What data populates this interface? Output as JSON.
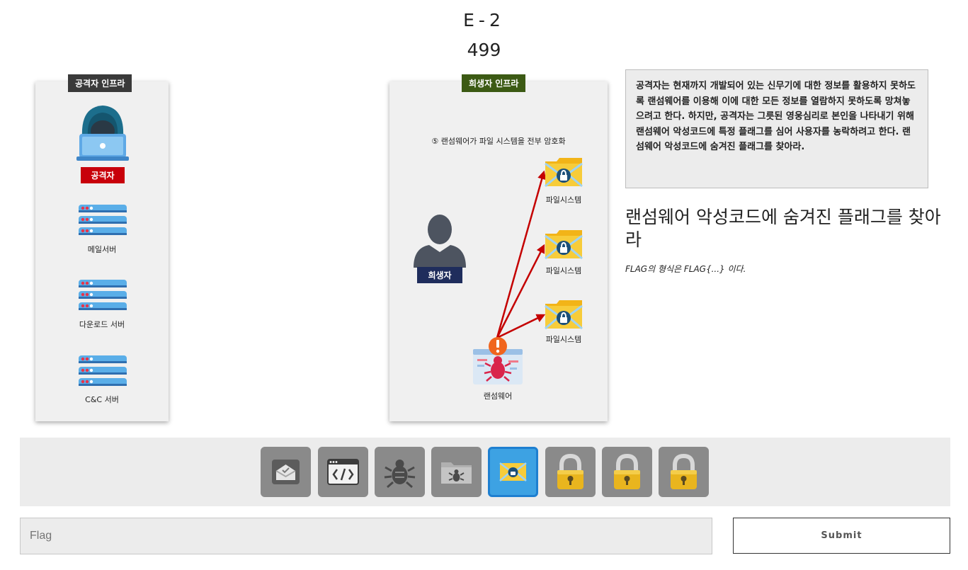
{
  "challenge": {
    "code": "E-2",
    "points": "499"
  },
  "attacker_panel": {
    "tag": "공격자 인프라",
    "attacker_badge": "공격자",
    "servers": [
      {
        "label": "메일서버"
      },
      {
        "label": "다운로드 서버"
      },
      {
        "label": "C&C 서버"
      }
    ]
  },
  "victim_panel": {
    "tag": "희생자 인프라",
    "step_caption": "⑤ 랜섬웨어가 파일 시스템을 전부 암호화",
    "victim_badge": "희생자",
    "filesystems": [
      {
        "label": "파일시스템"
      },
      {
        "label": "파일시스템"
      },
      {
        "label": "파일시스템"
      }
    ],
    "ransomware_label": "랜섬웨어"
  },
  "description": "공격자는 현재까지 개발되어 있는 신무기에 대한 정보를 활용하지 못하도록 랜섬웨어를 이용해 이에 대한 모든 정보를 열람하지 못하도록 망쳐놓으려고 한다. 하지만, 공격자는 그릇된 영웅심리로 본인을 나타내기 위해 랜섬웨어 악성코드에 특정 플래그를 심어 사용자를 농락하려고 한다. 랜섬웨어 악성코드에 숨겨진 플래그를 찾아라.",
  "task": {
    "title": "랜섬웨어 악성코드에 숨겨진 플래그를 찾아라",
    "hint": "FLAG의 형식은 FLAG{...} 이다."
  },
  "toolbar": {
    "items": [
      {
        "icon": "mail-icon",
        "state": "unlocked"
      },
      {
        "icon": "code-window-icon",
        "state": "unlocked"
      },
      {
        "icon": "bug-icon",
        "state": "unlocked"
      },
      {
        "icon": "infected-folder-icon",
        "state": "unlocked"
      },
      {
        "icon": "encrypted-envelope-icon",
        "state": "active"
      },
      {
        "icon": "padlock-icon",
        "state": "locked"
      },
      {
        "icon": "padlock-icon",
        "state": "locked"
      },
      {
        "icon": "padlock-icon",
        "state": "locked"
      }
    ]
  },
  "flag_form": {
    "placeholder": "Flag",
    "submit_label": "Submit"
  },
  "colors": {
    "attacker_tag": "#3a3a3a",
    "victim_tag": "#3c5a14",
    "attacker_badge": "#c8000a",
    "victim_badge": "#1f2d5c",
    "active_tool": "#3da2e3",
    "arrow": "#c40000"
  }
}
